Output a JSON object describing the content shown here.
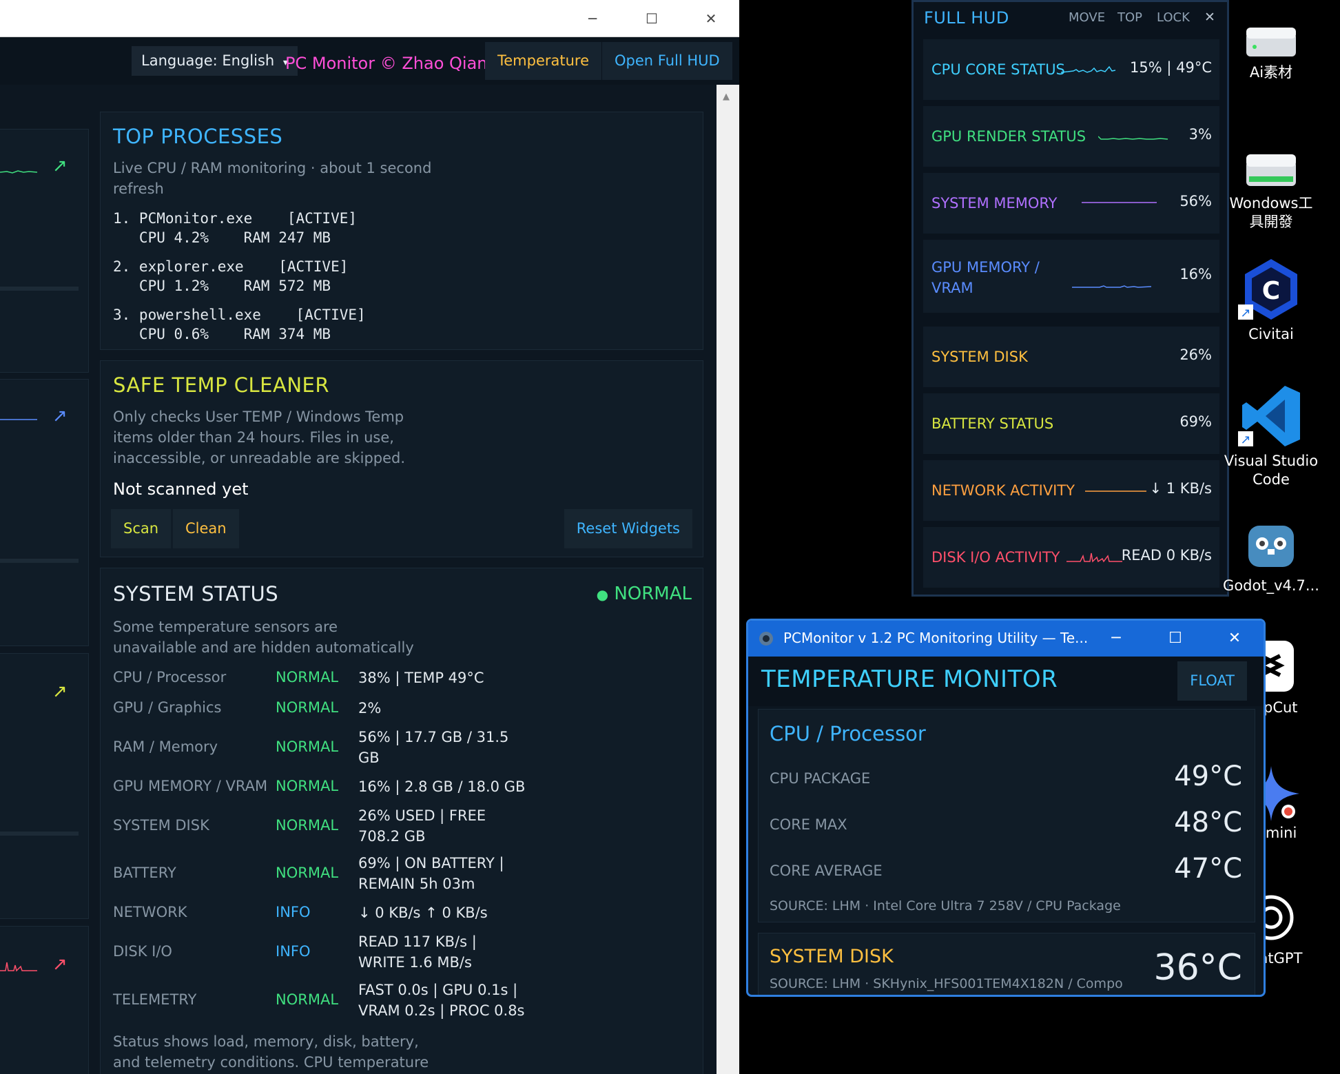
{
  "colors": {
    "cyan": "#3fb5ff",
    "green": "#40e080",
    "yellow": "#d8e640",
    "purple": "#b070ff",
    "blue": "#5a8cff",
    "orange": "#ffa040",
    "red": "#ff4f6a",
    "pink": "#ff4fd8",
    "gold": "#ffc040"
  },
  "window": {
    "minimize_icon": "─",
    "maximize_icon": "☐",
    "close_icon": "✕"
  },
  "toolbar": {
    "language": "Language: English",
    "language_caret": "▾",
    "credit": "PC Monitor © Zhao Qian",
    "temperature_label": "Temperature",
    "full_hud_label": "Open Full HUD"
  },
  "left_cards": {
    "arrow": "↗"
  },
  "top_processes": {
    "title": "TOP PROCESSES",
    "description": "Live CPU / RAM monitoring · about 1 second refresh",
    "items": [
      {
        "line1": "1. PCMonitor.exe    [ACTIVE]",
        "line2": "   CPU 4.2%    RAM 247 MB"
      },
      {
        "line1": "2. explorer.exe    [ACTIVE]",
        "line2": "   CPU 1.2%    RAM 572 MB"
      },
      {
        "line1": "3. powershell.exe    [ACTIVE]",
        "line2": "   CPU 0.6%    RAM 374 MB"
      }
    ]
  },
  "temp_cleaner": {
    "title": "SAFE TEMP CLEANER",
    "description": "Only checks User TEMP / Windows Temp items older than 24 hours. Files in use, inaccessible, or unreadable are skipped.",
    "status": "Not scanned yet",
    "scan_label": "Scan",
    "clean_label": "Clean",
    "reset_label": "Reset Widgets"
  },
  "system_status": {
    "title": "SYSTEM STATUS",
    "overall_dot": "●",
    "overall": "NORMAL",
    "description": "Some temperature sensors are unavailable and are hidden automatically",
    "rows": [
      {
        "label": "CPU / Processor",
        "state": "NORMAL",
        "value": "38%  |  TEMP 49°C"
      },
      {
        "label": "GPU / Graphics",
        "state": "NORMAL",
        "value": "2%"
      },
      {
        "label": "RAM / Memory",
        "state": "NORMAL",
        "value": "56%  |  17.7 GB / 31.5 GB"
      },
      {
        "label": "GPU MEMORY / VRAM",
        "state": "NORMAL",
        "value": "16%  |  2.8 GB / 18.0 GB"
      },
      {
        "label": "SYSTEM DISK",
        "state": "NORMAL",
        "value": "26% USED  |  FREE 708.2 GB"
      },
      {
        "label": "BATTERY",
        "state": "NORMAL",
        "value": "69%  |  ON BATTERY  |  REMAIN 5h 03m"
      },
      {
        "label": "NETWORK",
        "state": "INFO",
        "value": "↓ 0 KB/s  ↑ 0 KB/s"
      },
      {
        "label": "DISK I/O",
        "state": "INFO",
        "value": "READ 117 KB/s  |  WRITE 1.6 MB/s"
      },
      {
        "label": "TELEMETRY",
        "state": "NORMAL",
        "value": "FAST 0.0s  |  GPU 0.1s  |  VRAM 0.2s  |  PROC 0.8s"
      }
    ],
    "footer": "Status shows load, memory, disk, battery, and telemetry conditions. CPU temperature uses"
  },
  "hud": {
    "title": "FULL HUD",
    "move_label": "MOVE",
    "top_label": "TOP",
    "lock_label": "LOCK",
    "close_icon": "✕",
    "rows": [
      {
        "label": "CPU CORE STATUS",
        "value": "15%   |   49°C"
      },
      {
        "label": "GPU RENDER STATUS",
        "value": "3%"
      },
      {
        "label": "SYSTEM MEMORY",
        "value": "56%"
      },
      {
        "label": "GPU MEMORY / VRAM",
        "value": "16%"
      },
      {
        "label": "SYSTEM DISK",
        "value": "26%"
      },
      {
        "label": "BATTERY STATUS",
        "value": "69%"
      },
      {
        "label": "NETWORK ACTIVITY",
        "value": "↓ 1 KB/s"
      },
      {
        "label": "DISK I/O ACTIVITY",
        "value": "READ 0 KB/s"
      }
    ]
  },
  "temp_window": {
    "title": "PCMonitor v 1.2 PC Monitoring Utility — Te...",
    "heading": "TEMPERATURE MONITOR",
    "float_label": "FLOAT",
    "cpu_section": "CPU / Processor",
    "cpu_rows": [
      {
        "label": "CPU PACKAGE",
        "value": "49°C"
      },
      {
        "label": "CORE MAX",
        "value": "48°C"
      },
      {
        "label": "CORE AVERAGE",
        "value": "47°C"
      }
    ],
    "cpu_source": "SOURCE: LHM · Intel Core Ultra 7 258V / CPU Package",
    "disk_section": "SYSTEM DISK",
    "disk_value": "36°C",
    "disk_source": "SOURCE: LHM · SKHynix_HFS001TEM4X182N / Compo"
  },
  "desktop": {
    "icons": [
      {
        "label": "Ai素材"
      },
      {
        "label": "Wondows工具開發"
      },
      {
        "label": "Civitai"
      },
      {
        "label": "Visual Studio Code"
      },
      {
        "label": "Godot_v4.7..."
      },
      {
        "label": "CapCut"
      },
      {
        "label": "Gemini"
      },
      {
        "label": "ChatGPT"
      }
    ]
  }
}
